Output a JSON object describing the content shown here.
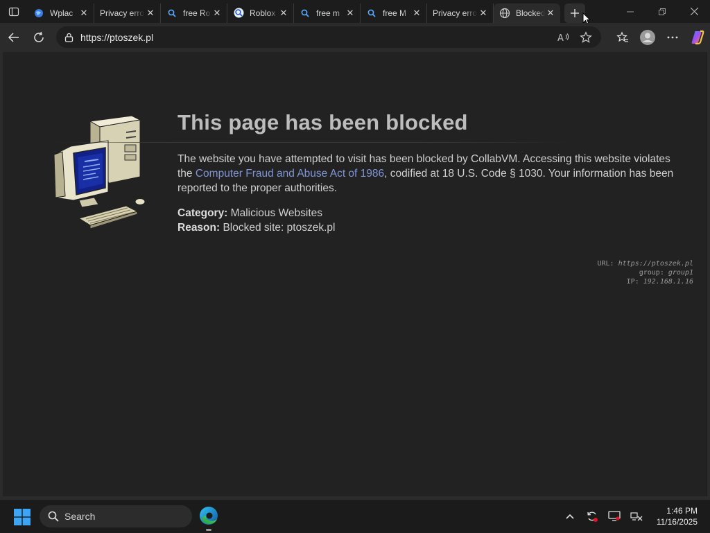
{
  "browser": {
    "tabs": [
      {
        "title": "Wplac",
        "icon": "globe-favicon"
      },
      {
        "title": "Privacy error",
        "icon": "none"
      },
      {
        "title": "free Ro",
        "icon": "search-icon"
      },
      {
        "title": "Roblox",
        "icon": "search-favicon"
      },
      {
        "title": "free m",
        "icon": "search-icon"
      },
      {
        "title": "free M",
        "icon": "search-icon"
      },
      {
        "title": "Privacy error",
        "icon": "none"
      },
      {
        "title": "Blocked",
        "icon": "globe-icon",
        "active": true
      }
    ],
    "address_url": "https://ptoszek.pl"
  },
  "page": {
    "heading": "This page has been blocked",
    "desc_before": "The website you have attempted to visit has been blocked by CollabVM. Accessing this website violates the ",
    "desc_link": "Computer Fraud and Abuse Act of 1986",
    "desc_after": ", codified at 18 U.S. Code § 1030. Your information has been reported to the proper authorities.",
    "category_label": "Category:",
    "category_value": "Malicious Websites",
    "reason_label": "Reason:",
    "reason_value": "Blocked site: ptoszek.pl",
    "info": {
      "url_label": "URL:",
      "url_value": "https://ptoszek.pl",
      "group_label": "group:",
      "group_value": "group1",
      "ip_label": "IP:",
      "ip_value": "192.168.1.16"
    }
  },
  "taskbar": {
    "search_label": "Search",
    "time": "1:46 PM",
    "date": "11/16/2025"
  },
  "colors": {
    "accent_link": "#7f95d8",
    "page_bg": "#222222",
    "chrome_bg": "#2b2b2b",
    "screen_blue": "#1a2fa6"
  }
}
